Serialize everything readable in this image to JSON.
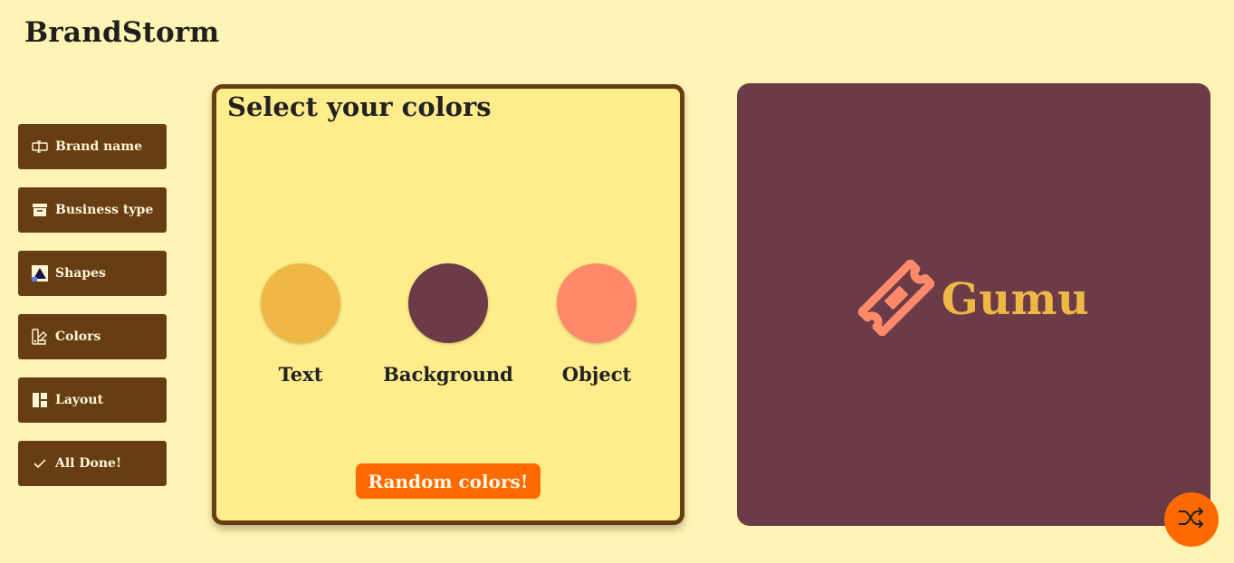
{
  "app": {
    "title": "BrandStorm"
  },
  "sidebar": {
    "items": [
      {
        "label": "Brand name",
        "icon": "text-cursor-icon"
      },
      {
        "label": "Business type",
        "icon": "archive-box-icon"
      },
      {
        "label": "Shapes",
        "icon": "shapes-icon"
      },
      {
        "label": "Colors",
        "icon": "palette-icon"
      },
      {
        "label": "Layout",
        "icon": "layout-grid-icon"
      },
      {
        "label": "All Done!",
        "icon": "check-icon"
      }
    ]
  },
  "panel": {
    "title": "Select your colors",
    "swatches": [
      {
        "label": "Text",
        "color": "#efb845"
      },
      {
        "label": "Background",
        "color": "#6b3b47"
      },
      {
        "label": "Object",
        "color": "#ff8a6b"
      }
    ],
    "random_button": "Random colors!"
  },
  "preview": {
    "brand_name": "Gumu",
    "background_color": "#6b3b47",
    "text_color": "#efb845",
    "object_color": "#ff8a6b",
    "object_icon": "ticket-icon"
  },
  "fab": {
    "icon": "shuffle-icon"
  },
  "colors": {
    "page_background": "#fff4b3",
    "nav_button": "#673e14",
    "panel_background": "#ffed8c",
    "accent": "#ff6a00"
  }
}
